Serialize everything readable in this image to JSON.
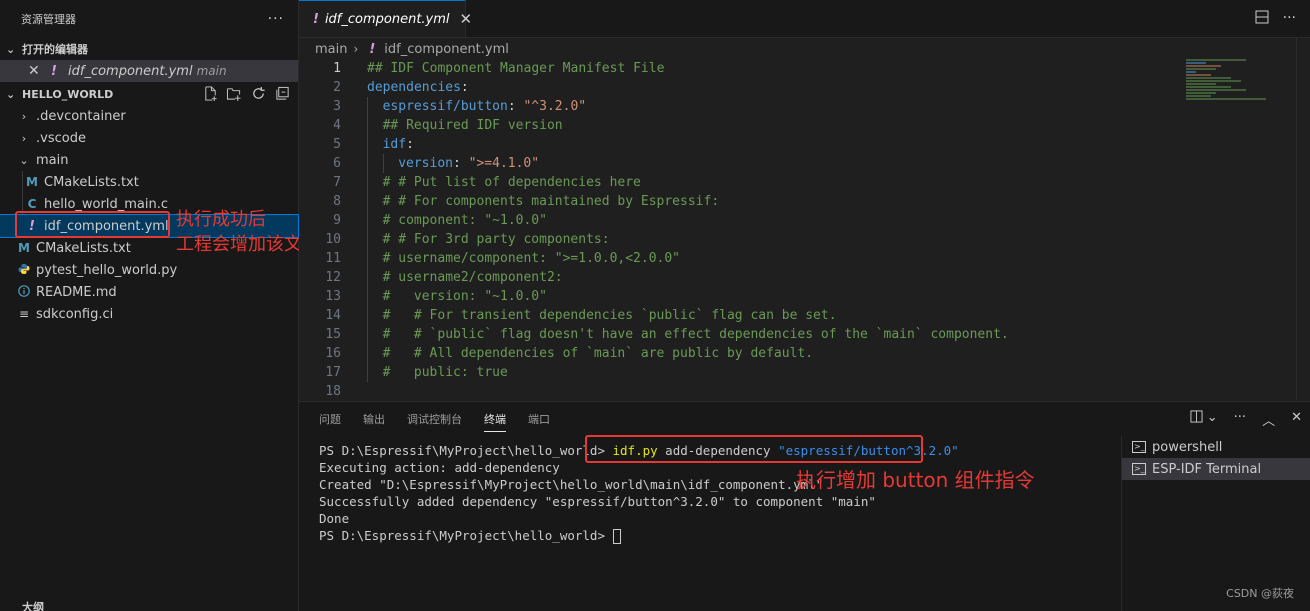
{
  "sidebar": {
    "title": "资源管理器",
    "more": "···",
    "open_editors_title": "打开的编辑器",
    "open_editor": {
      "name": "idf_component.yml",
      "desc": "main",
      "icon": "!"
    },
    "folder_title": "HELLO_WORLD",
    "tree": [
      {
        "label": ".devcontainer",
        "twisty": "›"
      },
      {
        "label": ".vscode",
        "twisty": "›"
      },
      {
        "label": "main",
        "twisty": "⌄"
      },
      {
        "label": "CMakeLists.txt",
        "icon": "M"
      },
      {
        "label": "hello_world_main.c",
        "icon": "C"
      },
      {
        "label": "idf_component.yml",
        "icon": "!"
      },
      {
        "label": "CMakeLists.txt",
        "icon": "M"
      },
      {
        "label": "pytest_hello_world.py",
        "icon": "py"
      },
      {
        "label": "README.md",
        "icon": "i"
      },
      {
        "label": "sdkconfig.ci",
        "icon": "≡"
      }
    ],
    "outline_title": "大纲",
    "annotation": [
      "执行成功后",
      "工程会增加该文件"
    ]
  },
  "editor": {
    "tab_label": "idf_component.yml",
    "breadcrumb": [
      "main",
      "idf_component.yml"
    ],
    "lines": [
      "## IDF Component Manager Manifest File",
      "dependencies:",
      "  espressif/button: \"^3.2.0\"",
      "  ## Required IDF version",
      "  idf:",
      "    version: \">=4.1.0\"",
      "  # # Put list of dependencies here",
      "  # # For components maintained by Espressif:",
      "  # component: \"~1.0.0\"",
      "  # # For 3rd party components:",
      "  # username/component: \">=1.0.0,<2.0.0\"",
      "  # username2/component2:",
      "  #   version: \"~1.0.0\"",
      "  #   # For transient dependencies `public` flag can be set.",
      "  #   # `public` flag doesn't have an effect dependencies of the `main` component.",
      "  #   # All dependencies of `main` are public by default.",
      "  #   public: true",
      ""
    ]
  },
  "panel": {
    "tabs": [
      "问题",
      "输出",
      "调试控制台",
      "终端",
      "端口"
    ],
    "active_tab": "终端",
    "terminal": {
      "prompt": "PS D:\\Espressif\\MyProject\\hello_world> ",
      "cmd": "idf.py",
      "cmd_args": " add-dependency ",
      "cmd_str": "\"espressif/button^3.2.0\"",
      "output": [
        "Executing action: add-dependency",
        "Created \"D:\\Espressif\\MyProject\\hello_world\\main\\idf_component.yml\"",
        "Successfully added dependency \"espressif/button^3.2.0\" to component \"main\"",
        "Done"
      ],
      "prompt2": "PS D:\\Espressif\\MyProject\\hello_world> "
    },
    "terminals": [
      "powershell",
      "ESP-IDF Terminal"
    ],
    "annotation": "执行增加 button 组件指令",
    "watermark": "CSDN @荻夜"
  },
  "colors": {
    "accent": "#0078d4",
    "annotation": "#e53935"
  }
}
